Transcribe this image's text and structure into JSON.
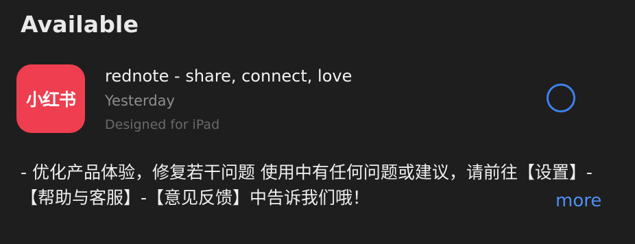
{
  "section": {
    "title": "Available"
  },
  "app": {
    "icon_label": "小红书",
    "icon_color": "#ee3e4f",
    "name": "rednote - share, connect, love",
    "date": "Yesterday",
    "designed_for": "Designed for iPad",
    "action_state": "updating",
    "action_icon": "progress-ring-icon",
    "action_color": "#3c82f0"
  },
  "release_notes": {
    "text": "- 优化产品体验，修复若干问题 使用中有任何问题或建议，请前往【设置】-【帮助与客服】-【意见反馈】中告诉我们哦！",
    "more_label": "more",
    "more_color": "#4d8ff5"
  }
}
